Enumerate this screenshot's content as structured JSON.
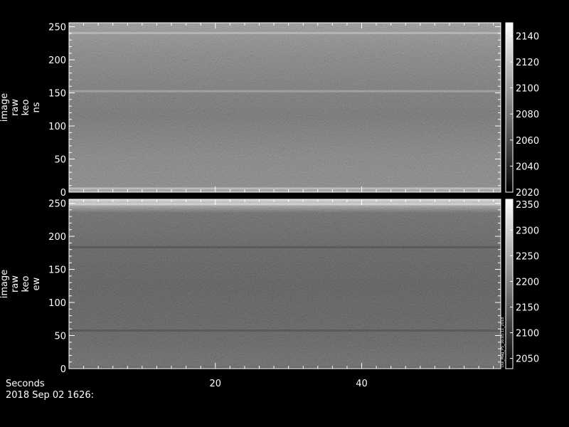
{
  "chart_data": [
    {
      "type": "heatmap",
      "name": "image raw keo ns",
      "ylabel_lines": [
        "image",
        "raw",
        "keo",
        "ns"
      ],
      "x_range": [
        0,
        59
      ],
      "y_range": [
        0,
        256
      ],
      "y_ticks": [
        0,
        50,
        100,
        150,
        200,
        250
      ],
      "colorbar": {
        "range": [
          2020,
          2150
        ],
        "ticks": [
          2020,
          2040,
          2060,
          2080,
          2100,
          2120,
          2140
        ]
      },
      "bands": [
        {
          "y": 5,
          "level": 0.85
        },
        {
          "y": 152,
          "level": 0.72
        },
        {
          "y": 240,
          "level": 0.8
        }
      ],
      "colormap": "grayscale"
    },
    {
      "type": "heatmap",
      "name": "image raw keo ew",
      "ylabel_lines": [
        "image",
        "raw",
        "keo",
        "ew"
      ],
      "x_range": [
        0,
        59
      ],
      "y_range": [
        0,
        256
      ],
      "y_ticks": [
        0,
        50,
        100,
        150,
        200,
        250
      ],
      "colorbar": {
        "range": [
          2030,
          2360
        ],
        "ticks": [
          2050,
          2100,
          2150,
          2200,
          2250,
          2300,
          2350
        ]
      },
      "bands": [
        {
          "y": 57,
          "level": 0.3
        },
        {
          "y": 183,
          "level": 0.3
        },
        {
          "y": 248,
          "level": 0.9
        }
      ],
      "colormap": "grayscale"
    }
  ],
  "x_axis": {
    "label": "Seconds",
    "ticks": [
      20,
      40
    ],
    "date_label": "2018 Sep 02 1626:"
  },
  "stamp": "Dui_Mag_PS_16:05:11_2018"
}
